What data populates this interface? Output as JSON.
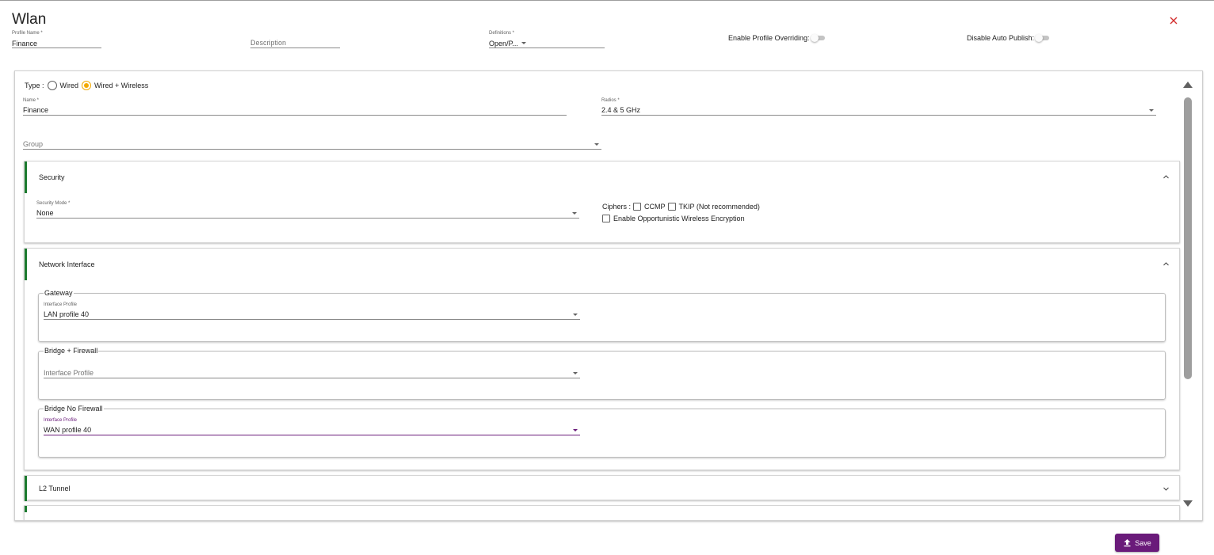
{
  "dialog": {
    "title": "Wlan"
  },
  "header": {
    "profile_name": {
      "label": "Profile Name *",
      "value": "Finance"
    },
    "description": {
      "placeholder": "Description"
    },
    "definitions": {
      "label": "Definitions *",
      "value": "Open/P..."
    },
    "enable_profile_overriding": {
      "label": "Enable Profile Overriding:",
      "on": false
    },
    "disable_auto_publish": {
      "label": "Disable Auto Publish:",
      "on": false
    }
  },
  "form": {
    "type": {
      "label": "Type :",
      "options": [
        "Wired",
        "Wired + Wireless"
      ],
      "selected": "Wired + Wireless"
    },
    "name": {
      "label": "Name *",
      "value": "Finance"
    },
    "radios": {
      "label": "Radios *",
      "value": "2.4 & 5 GHz"
    },
    "group": {
      "placeholder": "Group"
    }
  },
  "security": {
    "title": "Security",
    "security_mode": {
      "label": "Security Mode *",
      "value": "None"
    },
    "ciphers_label": "Ciphers :",
    "ccmp": {
      "label": "CCMP",
      "checked": false
    },
    "tkip": {
      "label": "TKIP (Not recommended)",
      "checked": false
    },
    "owe": {
      "label": "Enable Opportunistic Wireless Encryption",
      "checked": false
    }
  },
  "network_interface": {
    "title": "Network Interface",
    "gateway": {
      "legend": "Gateway",
      "label": "Interface Profile",
      "value": "LAN profile 40"
    },
    "bridge_firewall": {
      "legend": "Bridge + Firewall",
      "placeholder": "Interface Profile"
    },
    "bridge_no_firewall": {
      "legend": "Bridge No Firewall",
      "label": "Interface Profile",
      "value": "WAN profile 40"
    }
  },
  "l2_tunnel": {
    "title": "L2 Tunnel"
  },
  "footer": {
    "save_label": "Save"
  },
  "colors": {
    "accent": "#6a1b7a",
    "section_bar": "#1b7a2e",
    "radio": "#f2a900",
    "close": "#d32f2f"
  },
  "icons": [
    "close-icon",
    "chevron-up-icon",
    "chevron-down-icon",
    "upload-icon",
    "caret-down-icon"
  ]
}
